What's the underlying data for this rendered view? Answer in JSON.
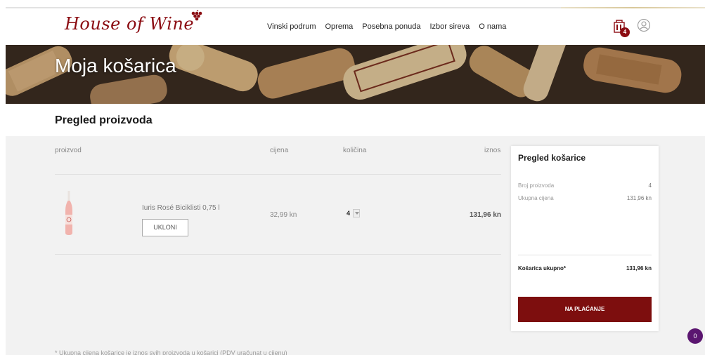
{
  "header": {
    "logo_text": "House of Wine",
    "nav": [
      "Vinski podrum",
      "Oprema",
      "Posebna ponuda",
      "Izbor sireva",
      "O nama"
    ],
    "cart_count": "4"
  },
  "banner": {
    "title": "Moja košarica"
  },
  "section": {
    "title": "Pregled proizvoda"
  },
  "table": {
    "headers": {
      "product": "proizvod",
      "price": "cijena",
      "quantity": "količina",
      "amount": "iznos"
    },
    "rows": [
      {
        "name": "Iuris Rosé Biciklisti 0,75 l",
        "remove_label": "UKLONI",
        "price": "32,99 kn",
        "quantity": "4",
        "amount": "131,96 kn"
      }
    ]
  },
  "summary": {
    "title": "Pregled košarice",
    "items": [
      {
        "label": "Broj proizvoda",
        "value": "4"
      },
      {
        "label": "Ukupna cijena",
        "value": "131,96 kn"
      }
    ],
    "total_label": "Košarica ukupno*",
    "total_value": "131,96 kn",
    "checkout_label": "NA PLAĆANJE"
  },
  "footnote": "* Ukupna cijena košarice je iznos svih proizvoda u košarici (PDV uračunat u cijenu)",
  "chat_badge": "0",
  "colors": {
    "brand": "#8b0c12",
    "button": "#7d0e0e",
    "chat": "#5b1670"
  }
}
